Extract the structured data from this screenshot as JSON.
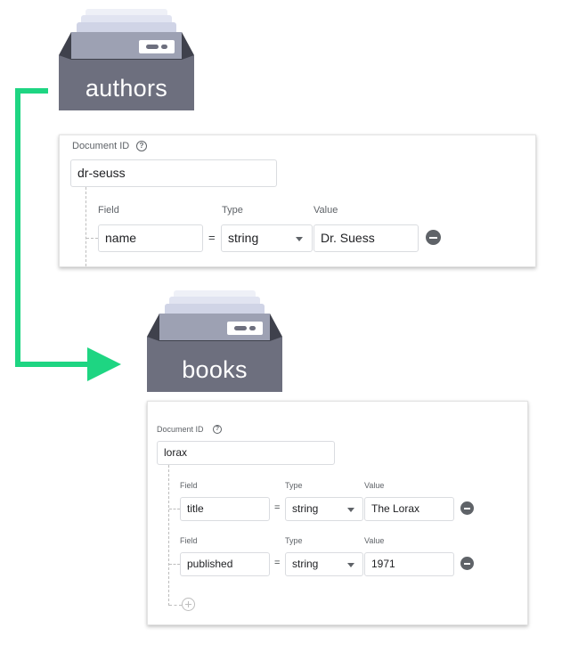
{
  "colors": {
    "connector_arrow": "#1ed582",
    "collection_icon": "#6d6f7e",
    "collection_icon_dark": "#3f414c"
  },
  "collections": [
    {
      "name": "authors",
      "icon": "file-drawer-icon",
      "document": {
        "id_label": "Document ID",
        "id_value": "dr-seuss",
        "fields": [
          {
            "field_label": "Field",
            "field": "name",
            "type_label": "Type",
            "type": "string",
            "value_label": "Value",
            "value": "Dr. Suess"
          }
        ]
      }
    },
    {
      "name": "books",
      "icon": "file-drawer-icon",
      "document": {
        "id_label": "Document ID",
        "id_value": "lorax",
        "fields": [
          {
            "field_label": "Field",
            "field": "title",
            "type_label": "Type",
            "type": "string",
            "value_label": "Value",
            "value": "The Lorax"
          },
          {
            "field_label": "Field",
            "field": "published",
            "type_label": "Type",
            "type": "string",
            "value_label": "Value",
            "value": "1971"
          }
        ]
      }
    }
  ],
  "symbols": {
    "equals": "=",
    "help": "?"
  }
}
